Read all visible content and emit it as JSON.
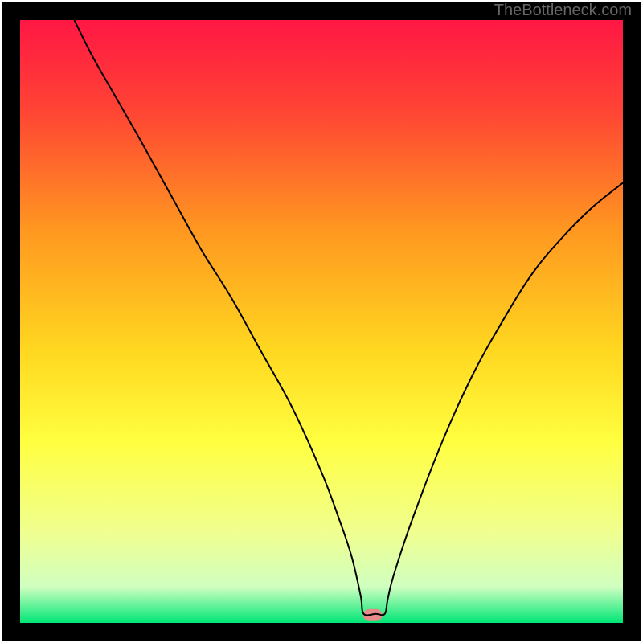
{
  "watermark": "TheBottleneck.com",
  "chart_data": {
    "type": "line",
    "title": "",
    "xlabel": "",
    "ylabel": "",
    "xlim": [
      0,
      100
    ],
    "ylim": [
      0,
      100
    ],
    "legend": false,
    "grid": false,
    "background_gradient": {
      "stops": [
        {
          "offset": 0,
          "color": "#ff1744"
        },
        {
          "offset": 15,
          "color": "#ff4434"
        },
        {
          "offset": 35,
          "color": "#ff9820"
        },
        {
          "offset": 55,
          "color": "#ffd820"
        },
        {
          "offset": 70,
          "color": "#ffff40"
        },
        {
          "offset": 85,
          "color": "#f0ff90"
        },
        {
          "offset": 94,
          "color": "#d0ffc0"
        },
        {
          "offset": 100,
          "color": "#00e676"
        }
      ]
    },
    "series": [
      {
        "name": "curve",
        "x": [
          9,
          12,
          16,
          20,
          25,
          30,
          35,
          40,
          45,
          50,
          53,
          55,
          56.5,
          57,
          59,
          60.5,
          61,
          62,
          65,
          70,
          75,
          80,
          85,
          90,
          95,
          100
        ],
        "y": [
          100,
          94,
          87,
          80,
          71,
          62,
          54,
          45,
          36,
          25,
          17,
          11,
          4.5,
          1.5,
          1.5,
          1.5,
          4,
          8,
          17,
          30,
          41,
          50,
          58,
          64,
          69,
          73
        ]
      }
    ],
    "marker": {
      "x": 58.5,
      "y": 1.3,
      "width": 3.2,
      "height": 2,
      "rx_frac": 0.5,
      "color": "#e68a8a"
    },
    "frame": {
      "outer_margin": 3,
      "frame_thickness": 22,
      "color": "#000000"
    }
  }
}
